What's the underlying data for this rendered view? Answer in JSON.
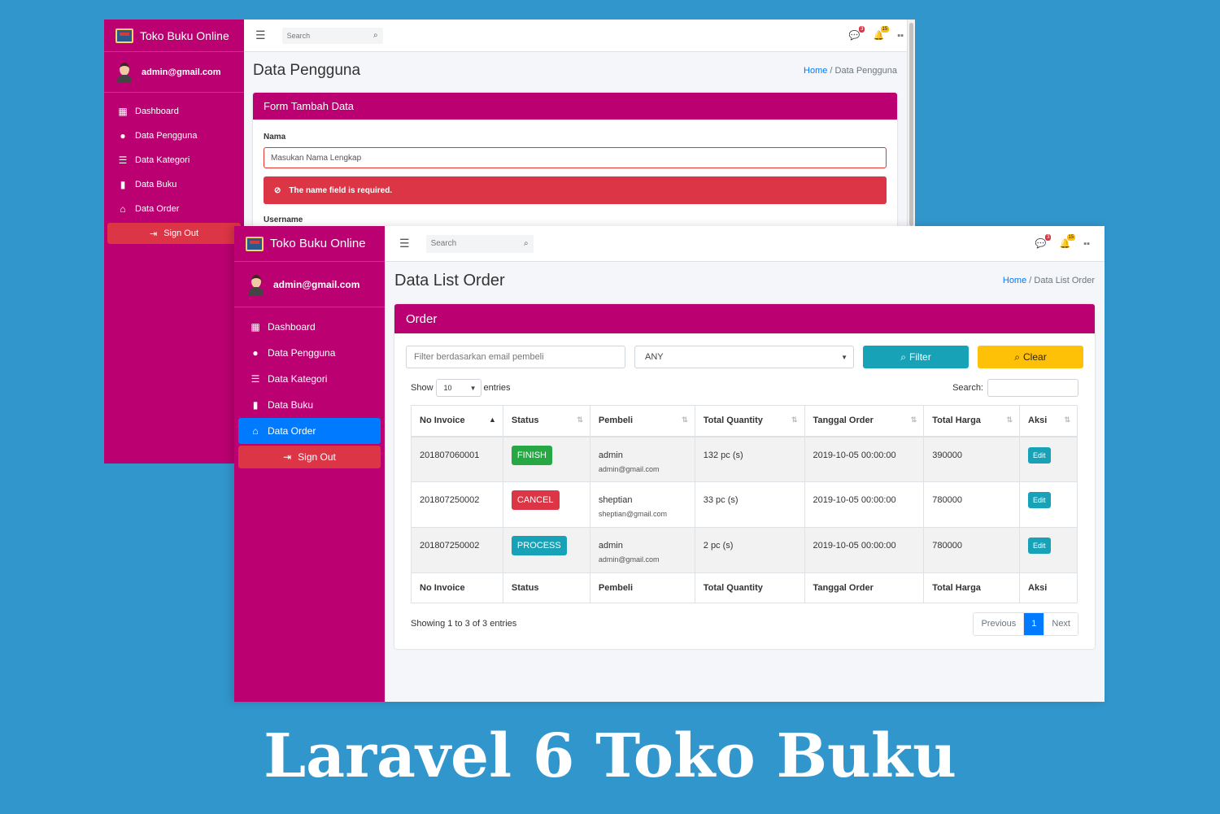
{
  "app": {
    "brand": "Toko Buku Online",
    "user_email": "admin@gmail.com"
  },
  "nav": [
    {
      "label": "Dashboard",
      "icon": "grid-icon"
    },
    {
      "label": "Data Pengguna",
      "icon": "user-circle-icon"
    },
    {
      "label": "Data Kategori",
      "icon": "list-icon"
    },
    {
      "label": "Data Buku",
      "icon": "book-icon"
    },
    {
      "label": "Data Order",
      "icon": "basket-icon"
    }
  ],
  "sign_out": "Sign Out",
  "topbar": {
    "search_placeholder": "Search",
    "messages_count": "3",
    "notifications_count": "15"
  },
  "colors": {
    "sidebar": "#bb0071",
    "active": "#007bff",
    "danger": "#dc3545",
    "info": "#17a2b8",
    "warning": "#ffc107",
    "success": "#28a745",
    "background": "#3196cc"
  },
  "back_window": {
    "page_title": "Data Pengguna",
    "breadcrumb": {
      "home": "Home",
      "separator": "/",
      "current": "Data Pengguna"
    },
    "card_title": "Form Tambah Data",
    "name_label": "Nama",
    "name_placeholder": "Masukan Nama Lengkap",
    "error": "The name field is required.",
    "username_label": "Username"
  },
  "front_window": {
    "page_title": "Data List Order",
    "breadcrumb": {
      "home": "Home",
      "separator": "/",
      "current": "Data List Order"
    },
    "card_title": "Order",
    "filter": {
      "email_placeholder": "Filter berdasarkan email pembeli",
      "status_selected": "ANY",
      "filter_button": "Filter",
      "clear_button": "Clear"
    },
    "length": {
      "show": "Show",
      "value": "10",
      "entries": "entries"
    },
    "search_label": "Search:",
    "columns": [
      "No Invoice",
      "Status",
      "Pembeli",
      "Total Quantity",
      "Tanggal Order",
      "Total Harga",
      "Aksi"
    ],
    "rows": [
      {
        "invoice": "201807060001",
        "status": "FINISH",
        "buyer": "admin",
        "buyer_email": "admin@gmail.com",
        "quantity": "132 pc (s)",
        "date": "2019-10-05 00:00:00",
        "total": "390000",
        "action": "Edit"
      },
      {
        "invoice": "201807250002",
        "status": "CANCEL",
        "buyer": "sheptian",
        "buyer_email": "sheptian@gmail.com",
        "quantity": "33 pc (s)",
        "date": "2019-10-05 00:00:00",
        "total": "780000",
        "action": "Edit"
      },
      {
        "invoice": "201807250002",
        "status": "PROCESS",
        "buyer": "admin",
        "buyer_email": "admin@gmail.com",
        "quantity": "2 pc (s)",
        "date": "2019-10-05 00:00:00",
        "total": "780000",
        "action": "Edit"
      }
    ],
    "info": "Showing 1 to 3 of 3 entries",
    "pagination": {
      "previous": "Previous",
      "current": "1",
      "next": "Next"
    }
  },
  "caption": "Laravel 6 Toko Buku"
}
